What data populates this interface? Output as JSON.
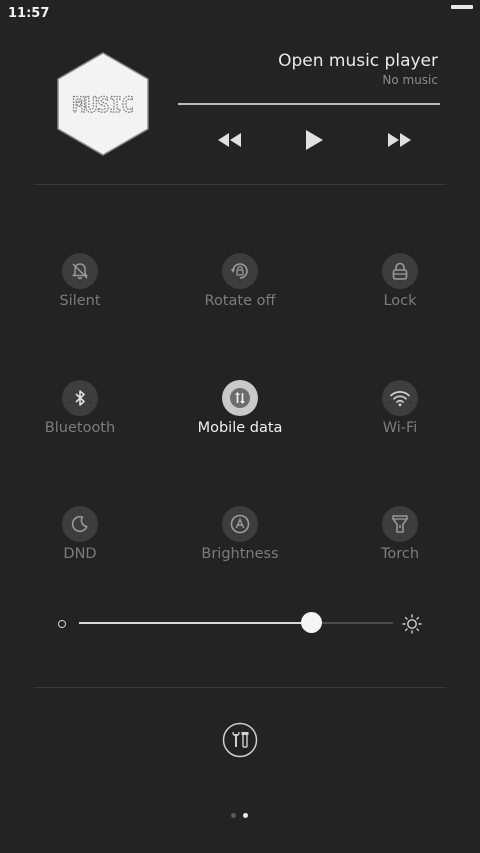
{
  "status_bar": {
    "time": "11:57"
  },
  "music": {
    "logo_text": "MUSIC",
    "title": "Open music player",
    "subtitle": "No music",
    "controls": {
      "previous_icon": "rewind-icon",
      "play_icon": "play-icon",
      "next_icon": "fast-forward-icon"
    }
  },
  "toggles": [
    {
      "label": "Silent",
      "icon": "bell-off-icon",
      "active": false
    },
    {
      "label": "Rotate off",
      "icon": "rotate-lock-icon",
      "active": false
    },
    {
      "label": "Lock",
      "icon": "lock-icon",
      "active": false
    },
    {
      "label": "Bluetooth",
      "icon": "bluetooth-icon",
      "active": false
    },
    {
      "label": "Mobile data",
      "icon": "mobile-data-icon",
      "active": true
    },
    {
      "label": "Wi-Fi",
      "icon": "wifi-icon",
      "active": false
    },
    {
      "label": "DND",
      "icon": "moon-icon",
      "active": false
    },
    {
      "label": "Brightness",
      "icon": "auto-brightness-icon",
      "active": false
    },
    {
      "label": "Torch",
      "icon": "torch-icon",
      "active": false
    }
  ],
  "brightness": {
    "level_percent": 74,
    "min_icon": "brightness-low-icon",
    "max_icon": "brightness-high-icon"
  },
  "settings_icon": "tools-icon",
  "pager": {
    "pages": 2,
    "current": 2
  },
  "colors": {
    "background": "#232323",
    "active_toggle": "#c9c9c9",
    "inactive_toggle": "#3d3d3d",
    "inactive_label": "#7c7c7c",
    "active_label": "#f0f0f0"
  }
}
